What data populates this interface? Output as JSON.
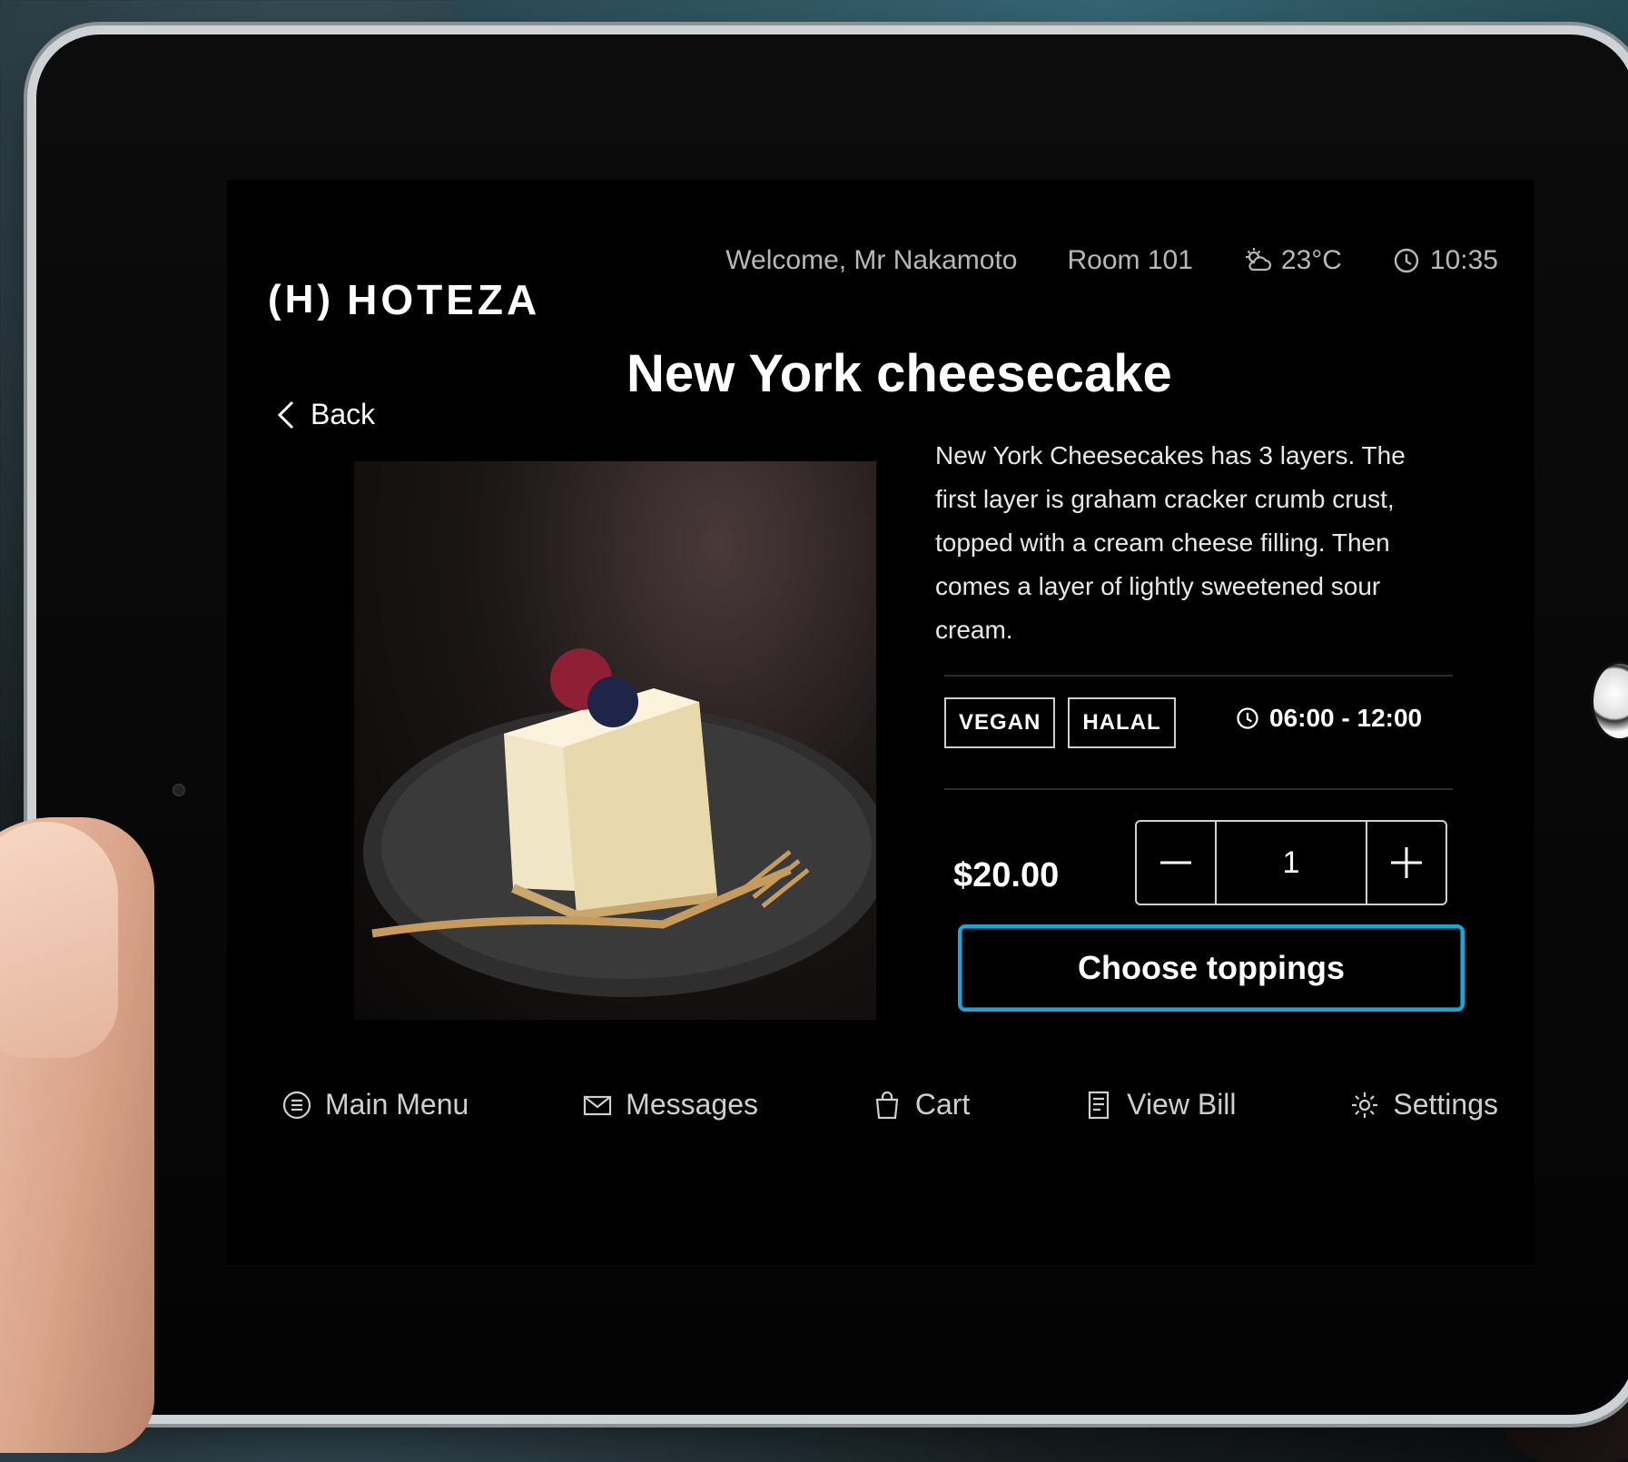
{
  "brand": {
    "name": "HOTEZA",
    "mark": "(H)"
  },
  "header": {
    "welcome": "Welcome, Mr Nakamoto",
    "room": "Room 101",
    "temperature": "23°C",
    "time": "10:35"
  },
  "nav": {
    "back_label": "Back"
  },
  "item": {
    "title": "New York cheesecake",
    "description": "New York Cheesecakes has 3 layers. The first layer is graham cracker crumb crust, topped with a cream cheese filling. Then comes a layer of lightly sweetened sour cream.",
    "tags": [
      "VEGAN",
      "HALAL"
    ],
    "hours": "06:00 - 12:00",
    "price": "$20.00",
    "quantity": "1",
    "cta_label": "Choose toppings"
  },
  "bottom_nav": {
    "main_menu": "Main Menu",
    "messages": "Messages",
    "cart": "Cart",
    "view_bill": "View Bill",
    "settings": "Settings"
  },
  "icons": [
    "weather-partly-sunny-icon",
    "clock-icon",
    "chevron-left-icon",
    "minus-icon",
    "plus-icon",
    "menu-icon",
    "envelope-icon",
    "shopping-bag-icon",
    "receipt-icon",
    "gear-icon"
  ],
  "colors": {
    "accent": "#1ea3d6",
    "screen_bg": "#000000",
    "text": "#ffffff",
    "muted": "#b8b8b8"
  }
}
